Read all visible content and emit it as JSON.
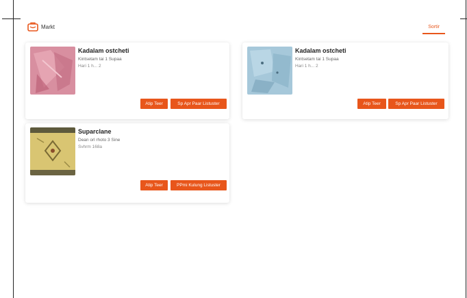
{
  "header": {
    "logo_text": "Markt",
    "right_button": "Sortir"
  },
  "cards": [
    {
      "title": "Kadalam ostcheti",
      "line1": "Kintsetam tai 1 Supaa",
      "line2": "Hari 1 h... 2",
      "button_primary": "Atip Teer",
      "button_secondary": "Sp Apr Paar Listuster",
      "thumb_color": "#d58a9b"
    },
    {
      "title": "Kadalam ostcheti",
      "line1": "Kintsetam tai 1 Supaa",
      "line2": "Hari 1 h... 2",
      "button_primary": "Atip Teer",
      "button_secondary": "Sp Apr Paar Listuster",
      "thumb_color": "#9fc3d6"
    },
    {
      "title": "Suparclane",
      "line1": "Dean orl rhoto 3 Sine",
      "line2": "Svhrm 168a",
      "button_primary": "Atip Teer",
      "button_secondary": "PPmi Kulung Listuster",
      "thumb_color": "#d6c26c"
    }
  ]
}
